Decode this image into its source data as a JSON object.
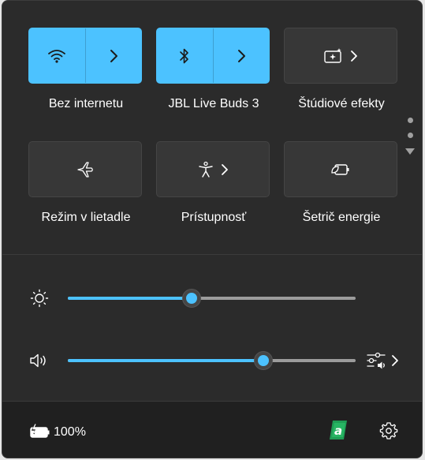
{
  "quick_settings": {
    "tiles": [
      {
        "label": "Bez internetu",
        "active": true,
        "icon": "wifi-icon",
        "has_chevron": true
      },
      {
        "label": "JBL Live Buds 3",
        "active": true,
        "icon": "bluetooth-icon",
        "has_chevron": true
      },
      {
        "label": "Štúdiové efekty",
        "active": false,
        "icon": "studio-effects-icon",
        "has_chevron": true
      },
      {
        "label": "Režim v lietadle",
        "active": false,
        "icon": "airplane-icon",
        "has_chevron": false
      },
      {
        "label": "Prístupnosť",
        "active": false,
        "icon": "accessibility-icon",
        "has_chevron": true
      },
      {
        "label": "Šetrič energie",
        "active": false,
        "icon": "energy-saver-icon",
        "has_chevron": false
      }
    ]
  },
  "sliders": {
    "brightness": {
      "icon": "brightness-icon",
      "level_percent": 43
    },
    "volume": {
      "icon": "speaker-icon",
      "level_percent": 68,
      "extra_icon": "audio-output-icon"
    }
  },
  "footer": {
    "battery_icon": "battery-charging-icon",
    "battery_text": "100%",
    "app_icon": "app-tray-icon",
    "settings_icon": "settings-gear-icon"
  },
  "colors": {
    "accent": "#4cc2ff",
    "panel_bg": "#2b2b2b",
    "tile_bg": "#373737",
    "footer_bg": "#202020",
    "app_icon_green": "#1f9d55"
  }
}
